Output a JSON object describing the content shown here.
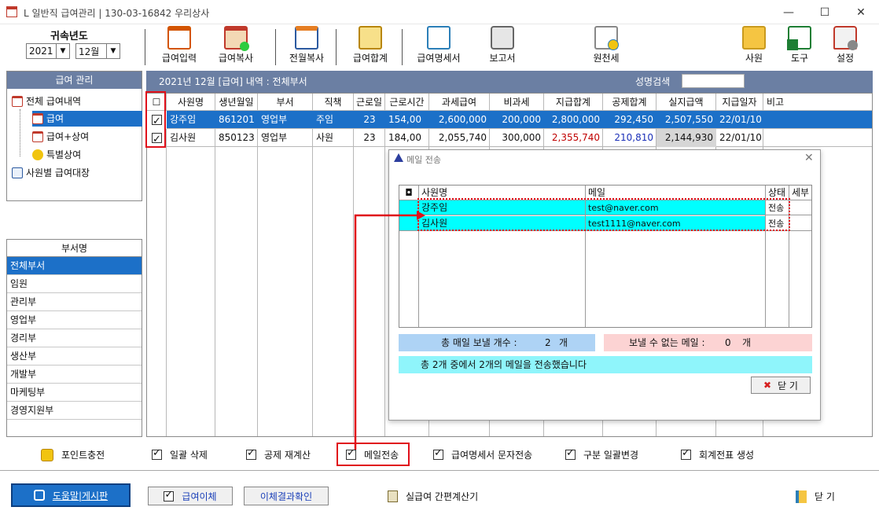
{
  "window": {
    "title": "L 일반직 급여관리 | 130-03-16842  우리상사",
    "minimize": "—",
    "maximize": "☐",
    "close": "✕"
  },
  "toolbar": {
    "year_label": "귀속년도",
    "year_value": "2021",
    "month_value": "12월",
    "buttons": [
      {
        "label": "급여입력",
        "icon": "calendar-person-icon"
      },
      {
        "label": "급여복사",
        "icon": "person-add-icon"
      },
      {
        "label": "전월복사",
        "icon": "calendar-copy-icon"
      },
      {
        "label": "급여합계",
        "icon": "sum-document-icon"
      },
      {
        "label": "급여명세서",
        "icon": "mail-statement-icon"
      },
      {
        "label": "보고서",
        "icon": "printer-icon"
      },
      {
        "label": "원천세",
        "icon": "tax-document-icon"
      },
      {
        "label": "사원",
        "icon": "employee-folder-icon"
      },
      {
        "label": "도구",
        "icon": "excel-icon"
      },
      {
        "label": "설정",
        "icon": "settings-house-icon"
      }
    ]
  },
  "tree": {
    "header": "급여 관리",
    "items": [
      "전체 급여내역",
      "급여",
      "급여+상여",
      "특별상여",
      "사원별 급여대장"
    ]
  },
  "dept": {
    "header": "부서명",
    "items": [
      "전체부서",
      "임원",
      "관리부",
      "영업부",
      "경리부",
      "생산부",
      "개발부",
      "마케팅부",
      "경영지원부"
    ]
  },
  "main": {
    "title": "2021년 12월 [급여] 내역 : 전체부서",
    "search_label": "성명검색",
    "columns": [
      "☐",
      "사원명",
      "생년월일",
      "부서",
      "직책",
      "근로일",
      "근로시간",
      "과세급여",
      "비과세",
      "지급합계",
      "공제합계",
      "실지급액",
      "지급일자",
      "비고"
    ],
    "rows": [
      {
        "name": "강주임",
        "birth": "861201",
        "dept": "영업부",
        "position": "주임",
        "days": "23",
        "hours": "154,00",
        "taxable": "2,600,000",
        "nontax": "200,000",
        "total": "2,800,000",
        "deduct": "292,450",
        "net": "2,507,550",
        "date": "22/01/10",
        "note": ""
      },
      {
        "name": "김사원",
        "birth": "850123",
        "dept": "영업부",
        "position": "사원",
        "days": "23",
        "hours": "184,00",
        "taxable": "2,055,740",
        "nontax": "300,000",
        "total": "2,355,740",
        "deduct": "210,810",
        "net": "2,144,930",
        "date": "22/01/10",
        "note": ""
      }
    ]
  },
  "mail_dialog": {
    "title": "메일 전송",
    "columns": [
      "◘",
      "사원명",
      "메일",
      "상태",
      "세부"
    ],
    "rows": [
      {
        "name": "강주임",
        "email": "test@naver.com",
        "status": "전송"
      },
      {
        "name": "김사원",
        "email": "test1111@naver.com",
        "status": "전송"
      }
    ],
    "total_label": "총 매일 보낼 개수 :",
    "total_value": "2",
    "total_unit": "개",
    "fail_label": "보낼 수 없는 메일 :",
    "fail_value": "0",
    "fail_unit": "개",
    "result": "총 2개 중에서  2개의 메일을 전송했습니다",
    "close_label": "닫 기"
  },
  "options": {
    "point": "포인트충전",
    "bulk_delete": "일괄 삭제",
    "recalc": "공제 재계산",
    "mail_send": "메일전송",
    "sms_send": "급여명세서 문자전송",
    "bulk_change": "구분 일괄변경",
    "voucher": "회계전표 생성"
  },
  "bottom": {
    "help": "도움말|게시판",
    "transfer": "급여이체",
    "transfer_check": "이체결과확인",
    "calc": "실급여 간편계산기",
    "close": "닫 기"
  },
  "colors": {
    "selected_row": "#1c70c8",
    "header_bar": "#6b7fa3",
    "mail_row": "#00ffff",
    "highlight": "#e0101a"
  }
}
